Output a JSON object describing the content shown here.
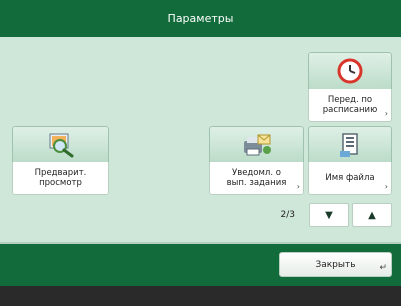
{
  "title": "Параметры",
  "tiles": {
    "preview": {
      "label": "Предварит.\nпросмотр",
      "icon": "magnifier-image-icon"
    },
    "job_notify": {
      "label": "Уведомл. о\nвып. задания",
      "icon": "printer-mail-icon"
    },
    "schedule_send": {
      "label": "Перед. по\nрасписанию",
      "icon": "clock-icon"
    },
    "file_name": {
      "label": "Имя файла",
      "icon": "document-icon"
    }
  },
  "pagination": {
    "text": "2/3",
    "down_icon": "triangle-down-icon",
    "up_icon": "triangle-up-icon"
  },
  "close_button": {
    "label": "Закрыть",
    "icon": "corner-arrow-icon"
  },
  "colors": {
    "title_bar": "#126b3a",
    "panel": "#cfe7d9",
    "footer": "#2a2a2a"
  }
}
